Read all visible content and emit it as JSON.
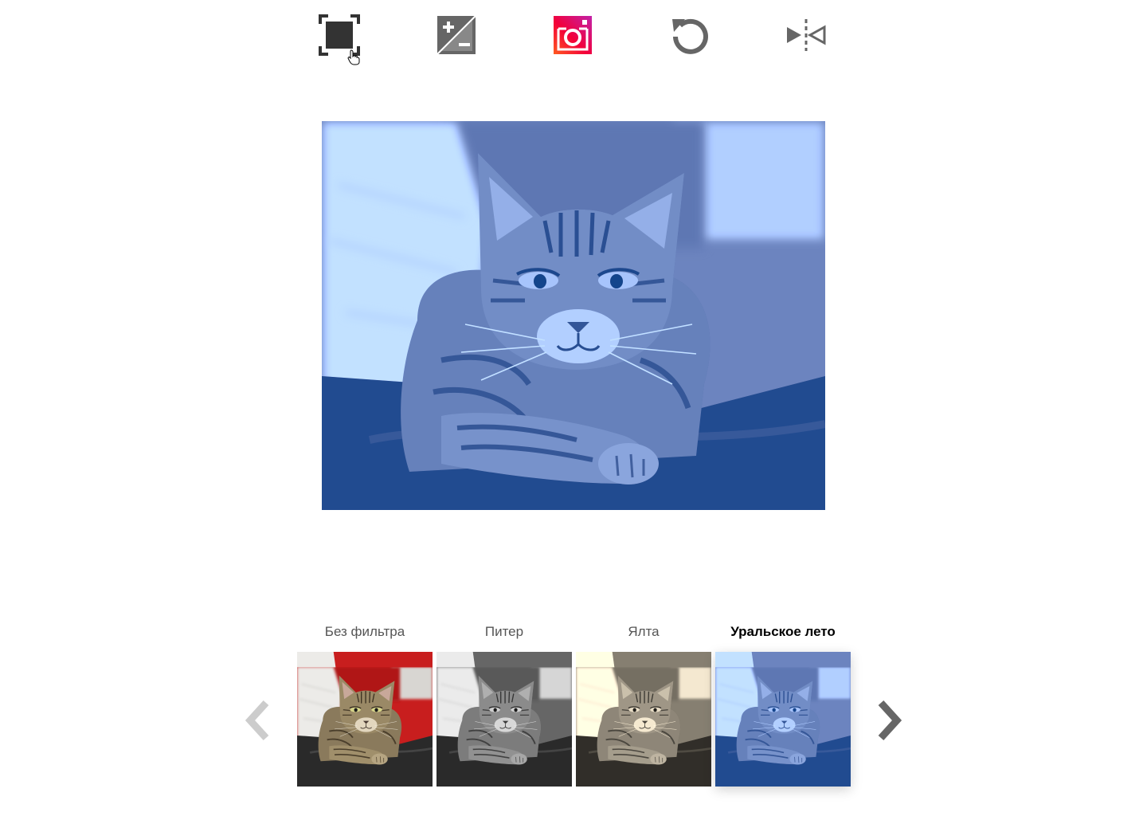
{
  "toolbar": {
    "tools": [
      {
        "name": "crop",
        "icon": "crop-fullscreen-icon",
        "color": "#333333"
      },
      {
        "name": "exposure",
        "icon": "exposure-plus-minus-icon",
        "color": "#666666"
      },
      {
        "name": "instagram",
        "icon": "instagram-filter-icon",
        "color_from": "#f3003a",
        "color_to": "#c222a8"
      },
      {
        "name": "rotate",
        "icon": "rotate-left-icon",
        "color": "#666666"
      },
      {
        "name": "flip",
        "icon": "flip-horizontal-icon",
        "color": "#666666"
      }
    ]
  },
  "main_image": {
    "subject": "tabby cat photo with blue filter",
    "active_filter_tint": "#3a63d8"
  },
  "filters": {
    "items": [
      {
        "label": "Без фильтра",
        "tint": "none",
        "active": false
      },
      {
        "label": "Питер",
        "tint": "grayscale",
        "active": false
      },
      {
        "label": "Ялта",
        "tint": "sepia",
        "active": false
      },
      {
        "label": "Уральское лето",
        "tint": "blue",
        "active": true
      }
    ],
    "prev_icon": "chevron-left-icon",
    "next_icon": "chevron-right-icon"
  },
  "colors": {
    "icon_dark": "#333333",
    "icon_gray": "#666666",
    "arrow_disabled": "#cccccc",
    "arrow_enabled": "#666666",
    "instagram_gradient_start": "#f3003a",
    "instagram_gradient_end": "#c222a8"
  }
}
